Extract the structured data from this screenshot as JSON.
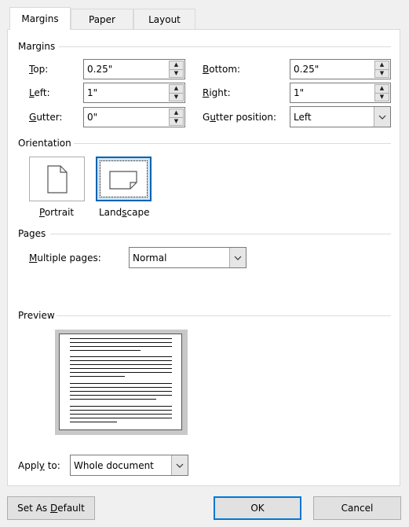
{
  "tabs": [
    {
      "label": "Margins",
      "active": true
    },
    {
      "label": "Paper",
      "active": false
    },
    {
      "label": "Layout",
      "active": false
    }
  ],
  "margins": {
    "section_title": "Margins",
    "top": {
      "mnemonic": "T",
      "rest": "op:",
      "value": "0.25\""
    },
    "bottom": {
      "mnemonic": "B",
      "rest": "ottom:",
      "value": "0.25\""
    },
    "left": {
      "mnemonic": "L",
      "rest": "eft:",
      "value": "1\""
    },
    "right": {
      "mnemonic": "R",
      "rest": "ight:",
      "value": "1\""
    },
    "gutter": {
      "mnemonic": "G",
      "rest": "utter:",
      "value": "0\""
    },
    "gutter_position": {
      "mnemonic": "u",
      "pre": "G",
      "rest": "tter position:",
      "value": "Left"
    }
  },
  "orientation": {
    "section_title": "Orientation",
    "portrait": {
      "mnemonic": "P",
      "rest": "ortrait"
    },
    "landscape": {
      "pre": "Land",
      "mnemonic": "s",
      "rest": "cape",
      "selected": true
    }
  },
  "pages": {
    "section_title": "Pages",
    "multiple_pages": {
      "mnemonic": "M",
      "rest": "ultiple pages:",
      "value": "Normal"
    }
  },
  "preview": {
    "section_title": "Preview"
  },
  "apply_to": {
    "label_pre": "Appl",
    "mnemonic": "y",
    "label_rest": " to:",
    "value": "Whole document"
  },
  "buttons": {
    "set_default": {
      "pre": "Set As ",
      "mnemonic": "D",
      "rest": "efault"
    },
    "ok": "OK",
    "cancel": "Cancel"
  },
  "colors": {
    "accent": "#0078d7",
    "selected_fill": "#cce4f7"
  }
}
